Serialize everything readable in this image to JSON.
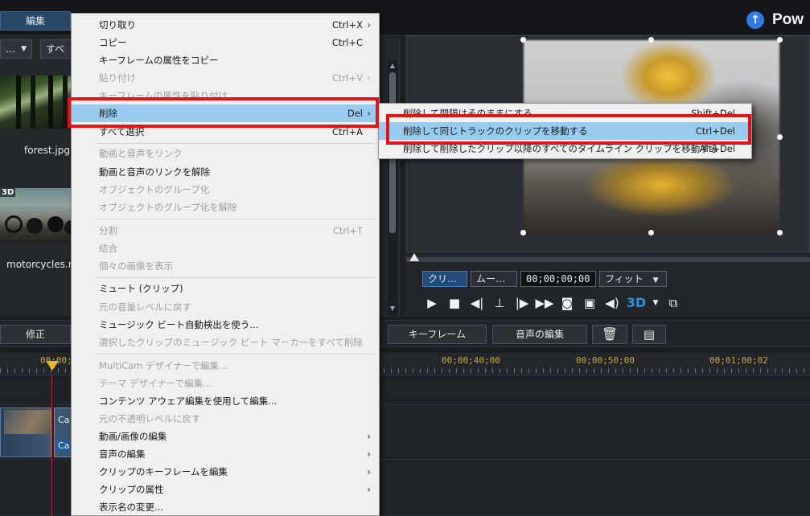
{
  "app": {
    "tab_edit": "編集",
    "brand": "Pow"
  },
  "library": {
    "dropdown1": "…",
    "dropdown2": "すべ",
    "items": [
      {
        "label": "forest.jpg"
      },
      {
        "label": "motorcycles.m",
        "badge": "3D"
      }
    ]
  },
  "preview": {
    "mode_clip": "クリ…",
    "mode_movie": "ムー…",
    "timecode": "00;00;00;00",
    "fit": "フィット"
  },
  "toolbar": {
    "fix": "修正",
    "keyframe": "キーフレーム",
    "audio_edit": "音声の編集"
  },
  "timeline": {
    "timecodes": [
      "00;00;",
      "00;00;40;00",
      "00;00;50;00",
      "00;01;00;02"
    ],
    "caption_clip_1": "Ca",
    "caption_clip_2": "Ca"
  },
  "context_menu": {
    "items": [
      {
        "label": "切り取り",
        "shortcut": "Ctrl+X",
        "submenu": true,
        "disabled": false
      },
      {
        "label": "コピー",
        "shortcut": "Ctrl+C",
        "disabled": false
      },
      {
        "label": "キーフレームの属性をコピー",
        "disabled": false
      },
      {
        "label": "貼り付け",
        "shortcut": "Ctrl+V",
        "submenu": true,
        "disabled": true
      },
      {
        "label": "キーフレームの属性を貼り付け",
        "disabled": true
      },
      {
        "label": "削除",
        "shortcut": "Del",
        "submenu": true,
        "highlighted": true
      },
      {
        "label": "すべて選択",
        "shortcut": "Ctrl+A",
        "disabled": false
      },
      {
        "label": "動画と音声をリンク",
        "disabled": true
      },
      {
        "label": "動画と音声のリンクを解除",
        "disabled": false
      },
      {
        "label": "オブジェクトのグループ化",
        "disabled": true
      },
      {
        "label": "オブジェクトのグループ化を解除",
        "disabled": true
      },
      {
        "label": "分割",
        "shortcut": "Ctrl+T",
        "disabled": true
      },
      {
        "label": "結合",
        "disabled": true
      },
      {
        "label": "個々の画像を表示",
        "disabled": true
      },
      {
        "label": "ミュート (クリップ)",
        "disabled": false
      },
      {
        "label": "元の音量レベルに戻す",
        "disabled": true
      },
      {
        "label": "ミュージック ビート自動検出を使う...",
        "disabled": false
      },
      {
        "label": "選択したクリップのミュージック ビート マーカーをすべて削除",
        "disabled": true
      },
      {
        "label": "MultiCam デザイナーで編集...",
        "disabled": true
      },
      {
        "label": "テーマ デザイナーで編集...",
        "disabled": true
      },
      {
        "label": "コンテンツ アウェア編集を使用して編集...",
        "disabled": false
      },
      {
        "label": "元の不透明レベルに戻す",
        "disabled": true
      },
      {
        "label": "動画/画像の編集",
        "submenu": true,
        "disabled": false
      },
      {
        "label": "音声の編集",
        "submenu": true,
        "disabled": false
      },
      {
        "label": "クリップのキーフレームを編集",
        "submenu": true,
        "disabled": false
      },
      {
        "label": "クリップの属性",
        "submenu": true,
        "disabled": false
      },
      {
        "label": "表示名の変更...",
        "disabled": false
      }
    ]
  },
  "delete_submenu": {
    "items": [
      {
        "label": "削除して間隔はそのままにする",
        "shortcut": "Shift+Del"
      },
      {
        "label": "削除して同じトラックのクリップを移動する",
        "shortcut": "Ctrl+Del",
        "highlighted": true
      },
      {
        "label": "削除して削除したクリップ以降のすべてのタイムライン クリップを移動する",
        "shortcut": "Alt+Del"
      }
    ]
  },
  "colors": {
    "highlight": "#99cbef",
    "annotation_red": "#e01414",
    "accent_blue": "#2f7be0",
    "timecode_gold": "#c9a23a"
  },
  "icons": [
    "play-icon",
    "stop-icon",
    "prev-frame-icon",
    "next-frame-icon",
    "fast-forward-icon",
    "snapshot-icon",
    "volume-icon",
    "3d-icon",
    "trash-icon",
    "chapter-icon",
    "up-arrow-icon"
  ]
}
